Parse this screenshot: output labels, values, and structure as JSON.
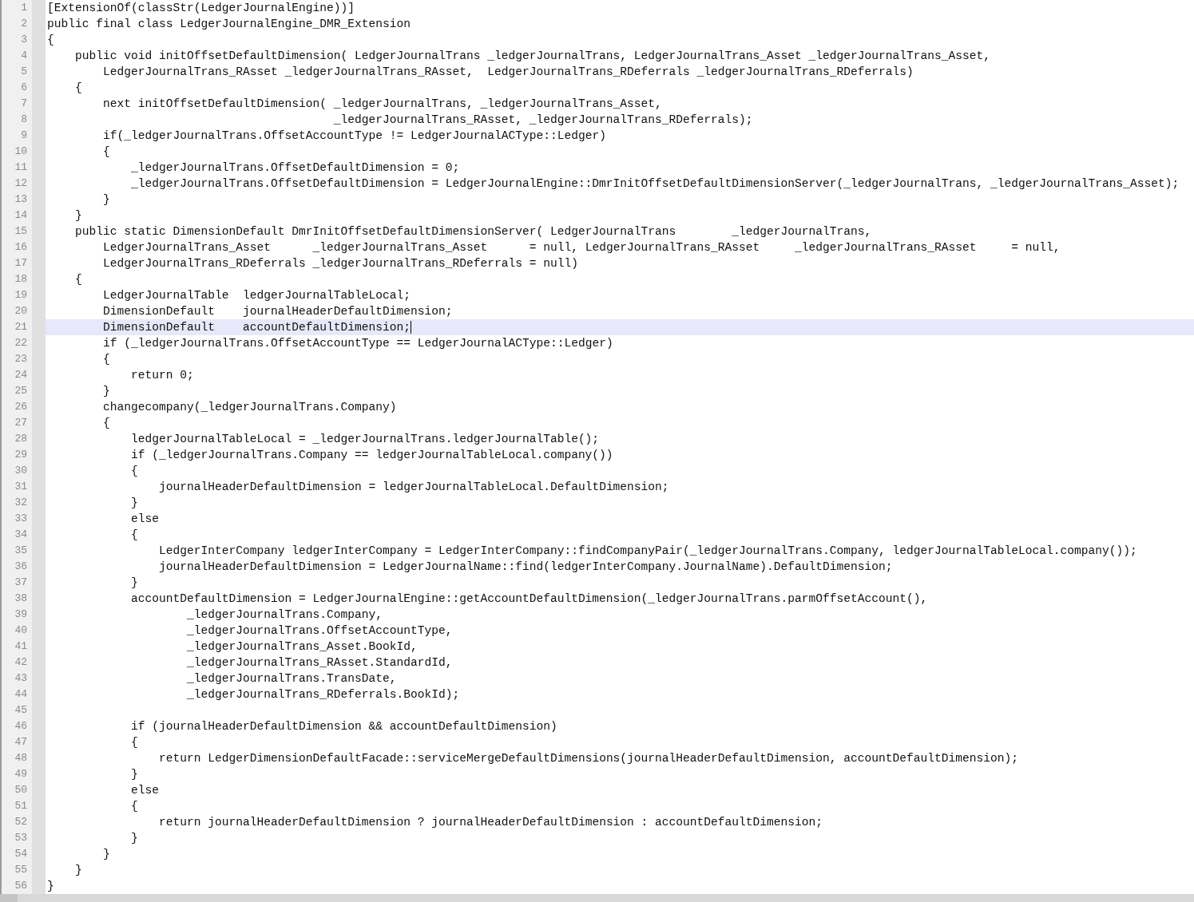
{
  "editor": {
    "lines": [
      {
        "number": "1",
        "text": "[ExtensionOf(classStr(LedgerJournalEngine))]",
        "current": false
      },
      {
        "number": "2",
        "text": "public final class LedgerJournalEngine_DMR_Extension",
        "current": false
      },
      {
        "number": "3",
        "text": "{",
        "current": false
      },
      {
        "number": "4",
        "text": "    public void initOffsetDefaultDimension( LedgerJournalTrans _ledgerJournalTrans, LedgerJournalTrans_Asset _ledgerJournalTrans_Asset,",
        "current": false
      },
      {
        "number": "5",
        "text": "        LedgerJournalTrans_RAsset _ledgerJournalTrans_RAsset,  LedgerJournalTrans_RDeferrals _ledgerJournalTrans_RDeferrals)",
        "current": false
      },
      {
        "number": "6",
        "text": "    {",
        "current": false
      },
      {
        "number": "7",
        "text": "        next initOffsetDefaultDimension( _ledgerJournalTrans, _ledgerJournalTrans_Asset,",
        "current": false
      },
      {
        "number": "8",
        "text": "                                         _ledgerJournalTrans_RAsset, _ledgerJournalTrans_RDeferrals);",
        "current": false
      },
      {
        "number": "9",
        "text": "        if(_ledgerJournalTrans.OffsetAccountType != LedgerJournalACType::Ledger)",
        "current": false
      },
      {
        "number": "10",
        "text": "        {",
        "current": false
      },
      {
        "number": "11",
        "text": "            _ledgerJournalTrans.OffsetDefaultDimension = 0;",
        "current": false
      },
      {
        "number": "12",
        "text": "            _ledgerJournalTrans.OffsetDefaultDimension = LedgerJournalEngine::DmrInitOffsetDefaultDimensionServer(_ledgerJournalTrans, _ledgerJournalTrans_Asset);",
        "current": false
      },
      {
        "number": "13",
        "text": "        }",
        "current": false
      },
      {
        "number": "14",
        "text": "    }",
        "current": false
      },
      {
        "number": "15",
        "text": "    public static DimensionDefault DmrInitOffsetDefaultDimensionServer( LedgerJournalTrans        _ledgerJournalTrans,",
        "current": false
      },
      {
        "number": "16",
        "text": "        LedgerJournalTrans_Asset      _ledgerJournalTrans_Asset      = null, LedgerJournalTrans_RAsset     _ledgerJournalTrans_RAsset     = null,",
        "current": false
      },
      {
        "number": "17",
        "text": "        LedgerJournalTrans_RDeferrals _ledgerJournalTrans_RDeferrals = null)",
        "current": false
      },
      {
        "number": "18",
        "text": "    {",
        "current": false
      },
      {
        "number": "19",
        "text": "        LedgerJournalTable  ledgerJournalTableLocal;",
        "current": false
      },
      {
        "number": "20",
        "text": "        DimensionDefault    journalHeaderDefaultDimension;",
        "current": false
      },
      {
        "number": "21",
        "text": "        DimensionDefault    accountDefaultDimension;",
        "current": true
      },
      {
        "number": "22",
        "text": "        if (_ledgerJournalTrans.OffsetAccountType == LedgerJournalACType::Ledger)",
        "current": false
      },
      {
        "number": "23",
        "text": "        {",
        "current": false
      },
      {
        "number": "24",
        "text": "            return 0;",
        "current": false
      },
      {
        "number": "25",
        "text": "        }",
        "current": false
      },
      {
        "number": "26",
        "text": "        changecompany(_ledgerJournalTrans.Company)",
        "current": false
      },
      {
        "number": "27",
        "text": "        {",
        "current": false
      },
      {
        "number": "28",
        "text": "            ledgerJournalTableLocal = _ledgerJournalTrans.ledgerJournalTable();",
        "current": false
      },
      {
        "number": "29",
        "text": "            if (_ledgerJournalTrans.Company == ledgerJournalTableLocal.company())",
        "current": false
      },
      {
        "number": "30",
        "text": "            {",
        "current": false
      },
      {
        "number": "31",
        "text": "                journalHeaderDefaultDimension = ledgerJournalTableLocal.DefaultDimension;",
        "current": false
      },
      {
        "number": "32",
        "text": "            }",
        "current": false
      },
      {
        "number": "33",
        "text": "            else",
        "current": false
      },
      {
        "number": "34",
        "text": "            {",
        "current": false
      },
      {
        "number": "35",
        "text": "                LedgerInterCompany ledgerInterCompany = LedgerInterCompany::findCompanyPair(_ledgerJournalTrans.Company, ledgerJournalTableLocal.company());",
        "current": false
      },
      {
        "number": "36",
        "text": "                journalHeaderDefaultDimension = LedgerJournalName::find(ledgerInterCompany.JournalName).DefaultDimension;",
        "current": false
      },
      {
        "number": "37",
        "text": "            }",
        "current": false
      },
      {
        "number": "38",
        "text": "            accountDefaultDimension = LedgerJournalEngine::getAccountDefaultDimension(_ledgerJournalTrans.parmOffsetAccount(),",
        "current": false
      },
      {
        "number": "39",
        "text": "                    _ledgerJournalTrans.Company,",
        "current": false
      },
      {
        "number": "40",
        "text": "                    _ledgerJournalTrans.OffsetAccountType,",
        "current": false
      },
      {
        "number": "41",
        "text": "                    _ledgerJournalTrans_Asset.BookId,",
        "current": false
      },
      {
        "number": "42",
        "text": "                    _ledgerJournalTrans_RAsset.StandardId,",
        "current": false
      },
      {
        "number": "43",
        "text": "                    _ledgerJournalTrans.TransDate,",
        "current": false
      },
      {
        "number": "44",
        "text": "                    _ledgerJournalTrans_RDeferrals.BookId);",
        "current": false
      },
      {
        "number": "45",
        "current": false
      },
      {
        "number": "46",
        "text": "            if (journalHeaderDefaultDimension && accountDefaultDimension)",
        "current": false
      },
      {
        "number": "47",
        "text": "            {",
        "current": false
      },
      {
        "number": "48",
        "text": "                return LedgerDimensionDefaultFacade::serviceMergeDefaultDimensions(journalHeaderDefaultDimension, accountDefaultDimension);",
        "current": false
      },
      {
        "number": "49",
        "text": "            }",
        "current": false
      },
      {
        "number": "50",
        "text": "            else",
        "current": false
      },
      {
        "number": "51",
        "text": "            {",
        "current": false
      },
      {
        "number": "52",
        "text": "                return journalHeaderDefaultDimension ? journalHeaderDefaultDimension : accountDefaultDimension;",
        "current": false
      },
      {
        "number": "53",
        "text": "            }",
        "current": false
      },
      {
        "number": "54",
        "text": "        }",
        "current": false
      },
      {
        "number": "55",
        "text": "    }",
        "current": false
      },
      {
        "number": "56",
        "text": "}",
        "current": false
      }
    ]
  }
}
